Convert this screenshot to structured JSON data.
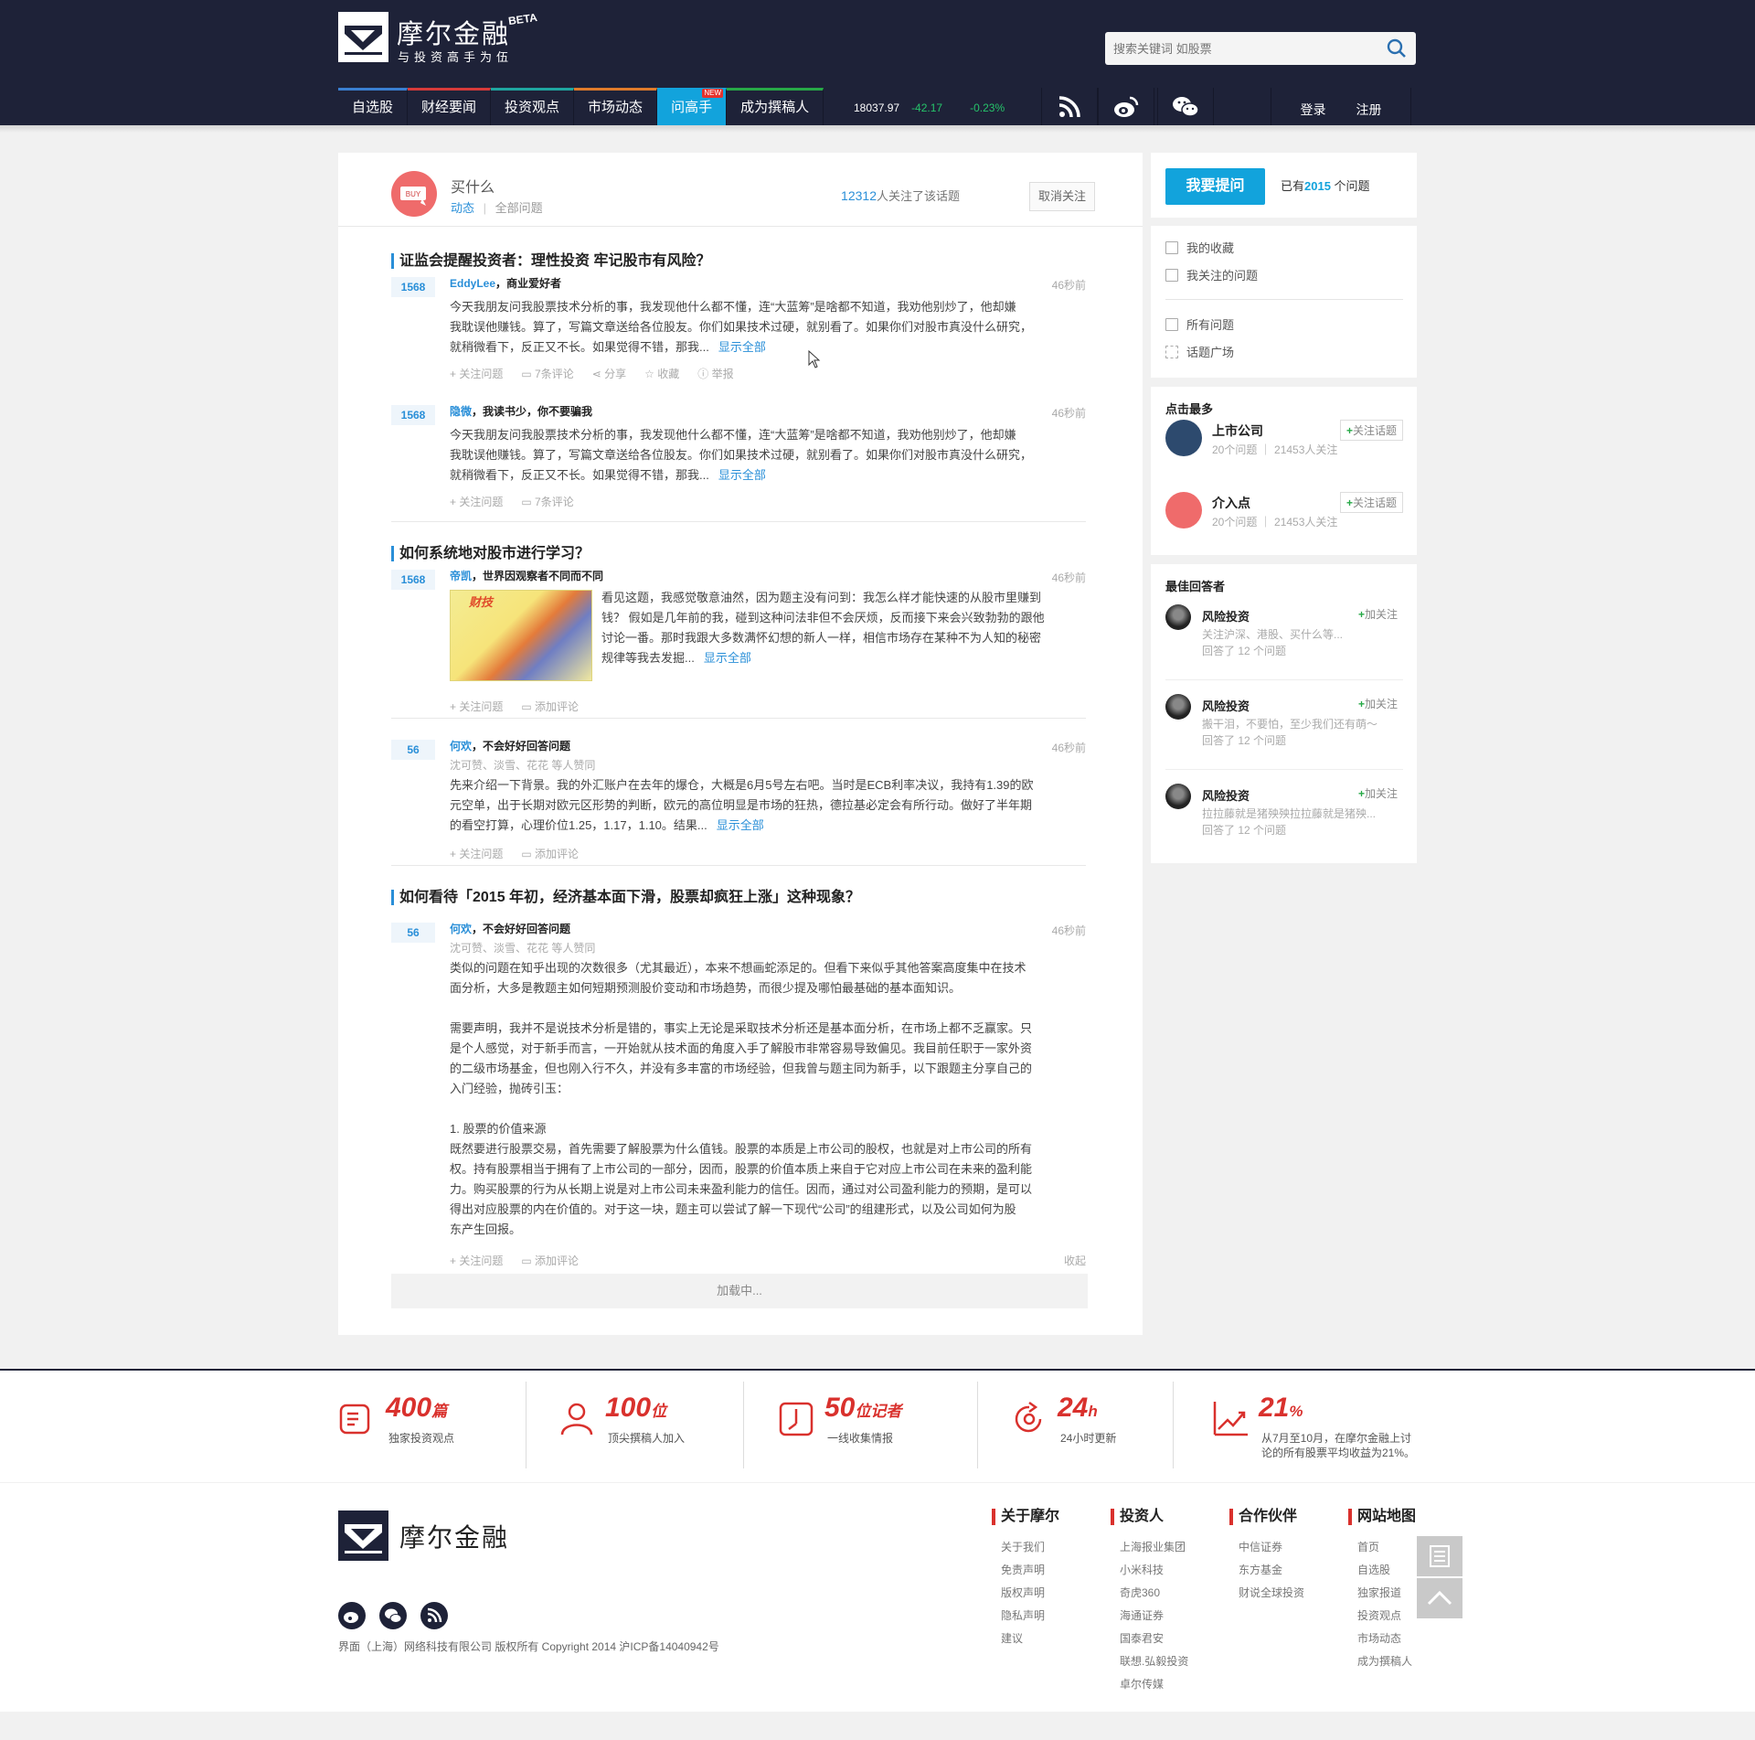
{
  "brand": {
    "name": "摩尔金融",
    "beta": "BETA",
    "slogan": "与投资高手为伍"
  },
  "search": {
    "placeholder": "搜索关键词 如股票"
  },
  "nav": {
    "items": [
      {
        "label": "自选股",
        "color": "#3a7fd0"
      },
      {
        "label": "财经要闻",
        "color": "#d63a3a"
      },
      {
        "label": "投资观点",
        "color": "#1fa6a0"
      },
      {
        "label": "市场动态",
        "color": "#e07b2b"
      },
      {
        "label": "问高手",
        "color": "#12a3dc",
        "badge": "NEW"
      },
      {
        "label": "成为撰稿人",
        "color": "#27a947"
      }
    ]
  },
  "ticker": {
    "index": "18037.97",
    "change": "-42.17",
    "percent": "-0.23%"
  },
  "auth": {
    "login": "登录",
    "register": "注册"
  },
  "topic": {
    "name": "买什么",
    "icon_text": "BUY",
    "tab_active": "动态",
    "tab_all": "全部问题",
    "follow_count": "12312",
    "follow_suffix": "人关注了该话题",
    "unfollow": "取消关注"
  },
  "questions": [
    {
      "title": "证监会提醒投资者：理性投资 牢记股市有风险？",
      "answers": [
        {
          "votes": "1568",
          "name": "EddyLee",
          "bio": "，商业爱好者",
          "time": "46秒前",
          "lines": [
            "今天我朋友问我股票技术分析的事，我发现他什么都不懂，连“大蓝筹”是啥都不知道，我劝他别炒了，他却嫌",
            "我耽误他赚钱。算了，写篇文章送给各位股友。你们如果技术过硬，就别看了。如果你们对股市真没什么研究，",
            "就稍微看下，反正又不长。如果觉得不错，那我..."
          ],
          "more": "显示全部",
          "actions": [
            "关注问题",
            "7条评论",
            "分享",
            "收藏",
            "举报"
          ]
        },
        {
          "votes": "1568",
          "name": "隐微",
          "bio": "，我读书少，你不要骗我",
          "time": "46秒前",
          "lines": [
            "今天我朋友问我股票技术分析的事，我发现他什么都不懂，连“大蓝筹”是啥都不知道，我劝他别炒了，他却嫌",
            "我耽误他赚钱。算了，写篇文章送给各位股友。你们如果技术过硬，就别看了。如果你们对股市真没什么研究，",
            "就稍微看下，反正又不长。如果觉得不错，那我..."
          ],
          "more": "显示全部",
          "actions": [
            "关注问题",
            "7条评论"
          ]
        }
      ]
    },
    {
      "title": "如何系统地对股市进行学习？",
      "answers": [
        {
          "votes": "1568",
          "name": "帝凯",
          "bio": "，世界因观察者不同而不同",
          "time": "46秒前",
          "lines": [
            "看见这题，我感觉敬意油然，因为题主没有问到：我怎么样才能快速的从股市里赚到",
            "钱？ 假如是几年前的我，碰到这种问法非但不会厌烦，反而接下来会兴致勃勃的跟他",
            "讨论一番。那时我跟大多数满怀幻想的新人一样，相信市场存在某种不为人知的秘密",
            "规律等我去发掘..."
          ],
          "more": "显示全部",
          "image_text": "财技",
          "actions": [
            "关注问题",
            "添加评论"
          ]
        },
        {
          "votes": "56",
          "name": "何欢",
          "bio": "，不会好好回答问题",
          "time": "46秒前",
          "endorse": "沈可赞、淡雪、花花 等人赞同",
          "lines": [
            "先来介绍一下背景。我的外汇账户在去年的爆仓，大概是6月5号左右吧。当时是ECB利率决议，我持有1.39的欧",
            "元空单，出于长期对欧元区形势的判断，欧元的高位明显是市场的狂热，德拉基必定会有所行动。做好了半年期",
            "的看空打算，心理价位1.25，1.17，1.10。结果..."
          ],
          "more": "显示全部",
          "actions": [
            "关注问题",
            "添加评论"
          ]
        }
      ]
    },
    {
      "title": "如何看待「2015 年初，经济基本面下滑，股票却疯狂上涨」这种现象？",
      "answers": [
        {
          "votes": "56",
          "name": "何欢",
          "bio": "，不会好好回答问题",
          "time": "46秒前",
          "endorse": "沈可赞、淡雪、花花 等人赞同",
          "lines": [
            "类似的问题在知乎出现的次数很多（尤其最近），本来不想画蛇添足的。但看下来似乎其他答案高度集中在技术",
            "面分析，大多是教题主如何短期预测股价变动和市场趋势，而很少提及哪怕最基础的基本面知识。",
            "",
            "需要声明，我并不是说技术分析是错的，事实上无论是采取技术分析还是基本面分析，在市场上都不乏赢家。只",
            "是个人感觉，对于新手而言，一开始就从技术面的角度入手了解股市非常容易导致偏见。我目前任职于一家外资",
            "的二级市场基金，但也刚入行不久，并没有多丰富的市场经验，但我曾与题主同为新手，以下跟题主分享自己的",
            "入门经验，抛砖引玉：",
            "",
            "1. 股票的价值来源",
            "既然要进行股票交易，首先需要了解股票为什么值钱。股票的本质是上市公司的股权，也就是对上市公司的所有",
            "权。持有股票相当于拥有了上市公司的一部分，因而，股票的价值本质上来自于它对应上市公司在未来的盈利能",
            "力。购买股票的行为从长期上说是对上市公司未来盈利能力的信任。因而，通过对公司盈利能力的预期，是可以",
            "得出对应股票的内在价值的。对于这一块，题主可以尝试了解一下现代“公司”的组建形式，以及公司如何为股",
            "东产生回报。"
          ],
          "actions": [
            "关注问题",
            "添加评论"
          ],
          "collapse": "收起"
        }
      ]
    }
  ],
  "loading": "加载中...",
  "sidebar": {
    "ask_button": "我要提问",
    "q_count_prefix": "已有",
    "q_count": "2015",
    "q_count_suffix": " 个问题",
    "links": [
      "我的收藏",
      "我关注的问题",
      "所有问题",
      "话题广场"
    ],
    "hot_title": "点击最多",
    "hot": [
      {
        "name": "上市公司",
        "meta": "20个问题 ｜ 21453人关注",
        "follow": "关注话题",
        "color": "#2d4a6e"
      },
      {
        "name": "介入点",
        "meta": "20个问题 ｜ 21453人关注",
        "follow": "关注话题",
        "color": "#ef6b6b"
      }
    ],
    "best_title": "最佳回答者",
    "best": [
      {
        "name": "风险投资",
        "desc": "关注沪深、港股、买什么等...",
        "stat": "回答了 12 个问题",
        "follow": "加关注"
      },
      {
        "name": "风险投资",
        "desc": "搬干泪，不要怕，至少我们还有萌～",
        "stat": "回答了 12 个问题",
        "follow": "加关注"
      },
      {
        "name": "风险投资",
        "desc": "拉拉藤就是猪殃殃拉拉藤就是猪殃...",
        "stat": "回答了 12 个问题",
        "follow": "加关注"
      }
    ]
  },
  "stats": [
    {
      "num": "400",
      "unit": "篇",
      "label": "独家投资观点"
    },
    {
      "num": "100",
      "unit": "位",
      "label": "顶尖撰稿人加入"
    },
    {
      "num": "50",
      "unit": "位记者",
      "label": "一线收集情报"
    },
    {
      "num": "24",
      "unit": "h",
      "label": "24小时更新"
    },
    {
      "num": "21",
      "unit": "%",
      "label": "从7月至10月，在摩尔金融上讨",
      "label2": "论的所有股票平均收益为21%。"
    }
  ],
  "footer": {
    "brand": "摩尔金融",
    "copyright": "界面（上海）网络科技有限公司 版权所有 Copyright 2014 沪ICP备14040942号",
    "cols": [
      {
        "title": "关于摩尔",
        "items": [
          "关于我们",
          "免责声明",
          "版权声明",
          "隐私声明",
          "建议"
        ]
      },
      {
        "title": "投资人",
        "items": [
          "上海报业集团",
          "小米科技",
          "奇虎360",
          "海通证券",
          "国泰君安",
          "联想.弘毅投资",
          "卓尔传媒"
        ]
      },
      {
        "title": "合作伙伴",
        "items": [
          "中信证券",
          "东方基金",
          "财说全球投资"
        ]
      },
      {
        "title": "网站地图",
        "items": [
          "首页",
          "自选股",
          "独家报道",
          "投资观点",
          "市场动态",
          "成为撰稿人"
        ]
      }
    ]
  }
}
